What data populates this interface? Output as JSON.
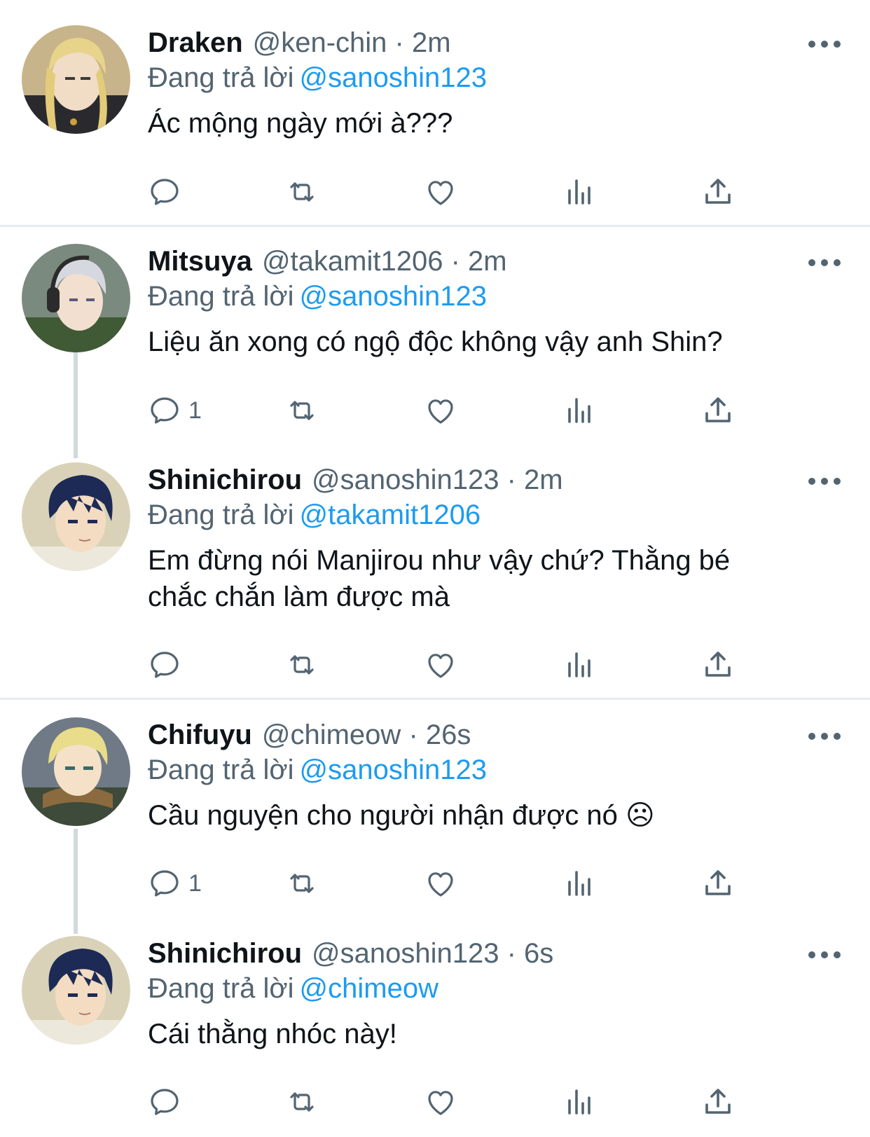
{
  "reply_prefix": "Đang trả lời",
  "tweets": [
    {
      "name": "Draken",
      "handle": "@ken-chin",
      "time": "· 2m",
      "reply_to": "@sanoshin123",
      "text": "Ác mộng ngày mới à???",
      "reply_count": "",
      "avatar": "draken-avatar"
    },
    {
      "name": "Mitsuya",
      "handle": "@takamit1206",
      "time": "· 2m",
      "reply_to": "@sanoshin123",
      "text": "Liệu ăn xong có ngộ độc không vậy anh Shin?",
      "reply_count": "1",
      "avatar": "mitsuya-avatar"
    },
    {
      "name": "Shinichirou",
      "handle": "@sanoshin123",
      "time": "· 2m",
      "reply_to": "@takamit1206",
      "text": "Em đừng nói Manjirou như vậy chứ? Thằng bé chắc chắn làm được mà",
      "reply_count": "",
      "avatar": "shinichirou-avatar"
    },
    {
      "name": "Chifuyu",
      "handle": "@chimeow",
      "time": "· 26s",
      "reply_to": "@sanoshin123",
      "text": "Cầu nguyện cho người nhận được nó ☹",
      "reply_count": "1",
      "avatar": "chifuyu-avatar"
    },
    {
      "name": "Shinichirou",
      "handle": "@sanoshin123",
      "time": "· 6s",
      "reply_to": "@chimeow",
      "text": "Cái thằng nhóc này!",
      "reply_count": "",
      "avatar": "shinichirou-avatar"
    }
  ],
  "colors": {
    "text": "#0f1419",
    "secondary": "#536471",
    "mention": "#1d9bf0",
    "divider": "#e6ecf0",
    "thread_line": "#cfd9de"
  },
  "icons": [
    "reply-icon",
    "retweet-icon",
    "like-icon",
    "analytics-icon",
    "share-icon",
    "more-icon"
  ]
}
